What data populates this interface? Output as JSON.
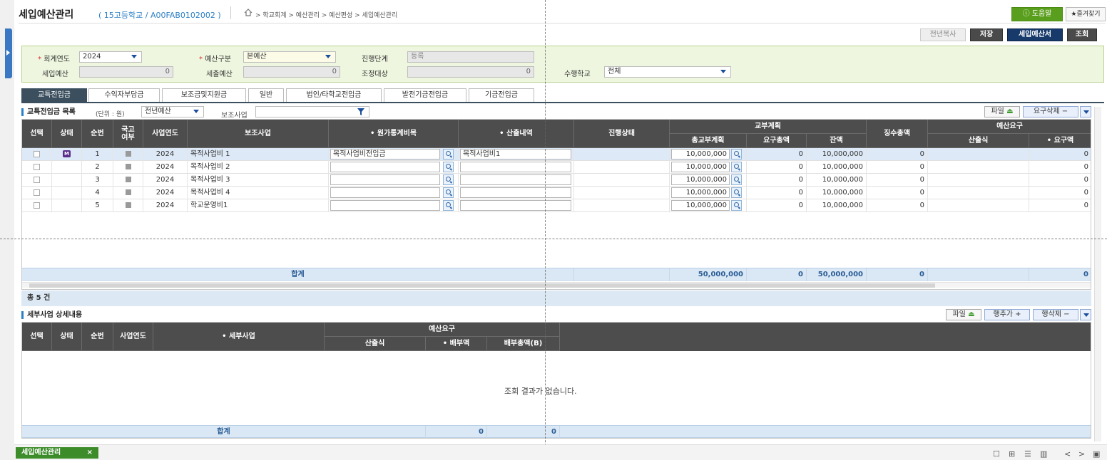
{
  "header": {
    "title": "세입예산관리",
    "subtitle": "( 15고등학교 / A00FAB0102002 )",
    "breadcrumb": "> 학교회계 > 예산관리 > 예산편성 > 세입예산관리",
    "help_label": "도움말",
    "fav_label": "★즐겨찾기"
  },
  "toolbar": {
    "copy_prev_label": "전년복사",
    "save_label": "저장",
    "budget_doc_label": "세입예산서",
    "search_label": "조회"
  },
  "form": {
    "fiscal_year_label": "회계연도",
    "fiscal_year_value": "2024",
    "budget_type_label": "예산구분",
    "budget_type_value": "본예산",
    "stage_label": "진행단계",
    "stage_value": "등록",
    "revenue_budget_label": "세입예산",
    "revenue_budget_value": "0",
    "expense_budget_label": "세출예산",
    "expense_budget_value": "0",
    "adjust_label": "조정대상",
    "adjust_value": "0",
    "school_label": "수행학교",
    "school_value": "전체"
  },
  "tabs": [
    {
      "label": "교특전입금"
    },
    {
      "label": "수익자부담금"
    },
    {
      "label": "보조금및지원금"
    },
    {
      "label": "일반"
    },
    {
      "label": "법인/타학교전입금"
    },
    {
      "label": "발전기금전입금"
    },
    {
      "label": "기금전입금"
    }
  ],
  "grid1": {
    "title": "교특전입금 목록",
    "unit": "(단위 : 원)",
    "prev_budget_select": "전년예산",
    "sub_project_label": "보조사업",
    "file_button": "파일",
    "delete_req_button": "요구삭제 −",
    "headers": {
      "select": "선택",
      "status": "상태",
      "seq": "순번",
      "national": "국고여부",
      "year": "사업연도",
      "sub_project": "보조사업",
      "stat_item": "• 원가통계비목",
      "calc_detail": "• 산출내역",
      "progress": "진행상태",
      "grant_plan": "교부계획",
      "total_plan": "총교부계획",
      "requested_total": "요구총액",
      "balance": "잔액",
      "collected_total": "징수총액",
      "budget_request": "예산요구",
      "formula": "산출식",
      "request_amount": "• 요구액"
    },
    "rows": [
      {
        "seq": "1",
        "year": "2024",
        "project": "목적사업비 1",
        "stat_item": "목적사업비전입금",
        "calc": "목적사업비1",
        "total_plan": "10,000,000",
        "requested": "0",
        "balance": "10,000,000",
        "collected": "0",
        "request_amt": "0",
        "badge": "M"
      },
      {
        "seq": "2",
        "year": "2024",
        "project": "목적사업비 2",
        "stat_item": "",
        "calc": "",
        "total_plan": "10,000,000",
        "requested": "0",
        "balance": "10,000,000",
        "collected": "0",
        "request_amt": "0",
        "badge": ""
      },
      {
        "seq": "3",
        "year": "2024",
        "project": "목적사업비 3",
        "stat_item": "",
        "calc": "",
        "total_plan": "10,000,000",
        "requested": "0",
        "balance": "10,000,000",
        "collected": "0",
        "request_amt": "0",
        "badge": ""
      },
      {
        "seq": "4",
        "year": "2024",
        "project": "목적사업비 4",
        "stat_item": "",
        "calc": "",
        "total_plan": "10,000,000",
        "requested": "0",
        "balance": "10,000,000",
        "collected": "0",
        "request_amt": "0",
        "badge": ""
      },
      {
        "seq": "5",
        "year": "2024",
        "project": "학교운영비1",
        "stat_item": "",
        "calc": "",
        "total_plan": "10,000,000",
        "requested": "0",
        "balance": "10,000,000",
        "collected": "0",
        "request_amt": "0",
        "badge": ""
      }
    ],
    "sum_label": "합계",
    "sum_total_plan": "50,000,000",
    "sum_requested": "0",
    "sum_balance": "50,000,000",
    "sum_collected": "0",
    "sum_request_amt": "0",
    "count_text": "총 5 건"
  },
  "grid2": {
    "title": "세부사업 상세내용",
    "file_button": "파일",
    "add_row_button": "행추가 +",
    "delete_row_button": "행삭제 −",
    "headers": {
      "select": "선택",
      "status": "상태",
      "seq": "순번",
      "year": "사업연도",
      "detail_project": "• 세부사업",
      "budget_request": "예산요구",
      "formula": "산출식",
      "allocation": "• 배부액",
      "allocation_total": "배부총액(B)"
    },
    "empty_message": "조회 결과가 없습니다.",
    "sum_label": "합계",
    "sum_allocation": "0",
    "sum_allocation_total": "0"
  },
  "bottom": {
    "tab_label": "세입예산관리",
    "tab_close": "×"
  },
  "colors": {
    "accent_blue": "#173a6b",
    "header_gray": "#4d4d4d",
    "form_green": "#eef6df",
    "help_green": "#5a9e1d",
    "sum_blue": "#dae8f5"
  }
}
